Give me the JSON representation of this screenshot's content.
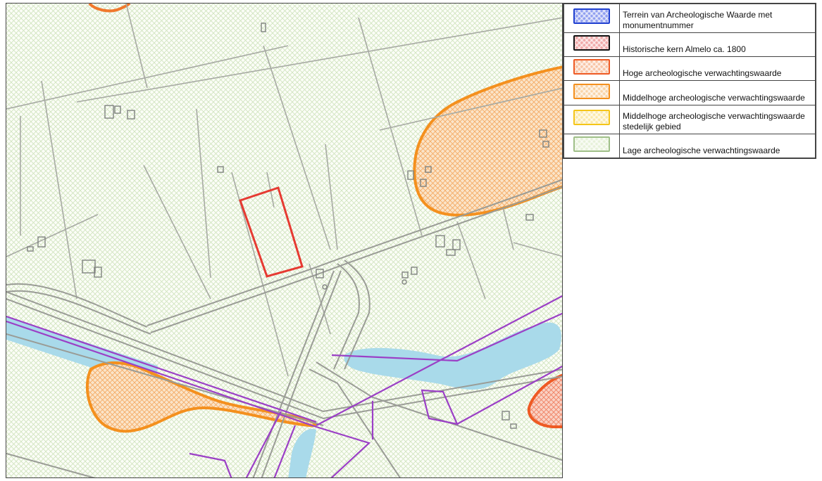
{
  "legend": {
    "items": [
      {
        "label": "Terrein van Archeologische Waarde met monumentnummer",
        "border": "#1f3fd0",
        "fill": "#8e9df0",
        "icon": "blue-hatch-swatch-icon"
      },
      {
        "label": "Historische kern Almelo ca. 1800",
        "border": "#111111",
        "fill": "#f0a6a6",
        "icon": "red-hatch-swatch-icon"
      },
      {
        "label": "Hoge archeologische verwachtingswaarde",
        "border": "#ee5a24",
        "fill": "#f8c3a3",
        "icon": "orange-red-hatch-swatch-icon"
      },
      {
        "label": "Middelhoge archeologische verwachtingswaarde",
        "border": "#f4901e",
        "fill": "#f9d3a6",
        "icon": "orange-hatch-swatch-icon"
      },
      {
        "label": "Middelhoge archeologische verwachtingswaarde stedelijk gebied",
        "border": "#f5c518",
        "fill": "#fbe9a6",
        "icon": "yellow-hatch-swatch-icon"
      },
      {
        "label": "Lage archeologische verwachtingswaarde",
        "border": "#9fbf88",
        "fill": "#e6f1d9",
        "icon": "green-hatch-swatch-icon"
      }
    ]
  },
  "map": {
    "colors": {
      "low_hatch": "#cfe3bd",
      "orange_zone": "#f4901e",
      "orange_fill": "#f9d9b3",
      "high_zone": "#ee5a24",
      "high_fill": "#f7c2b0",
      "water": "#a9daea",
      "study_area": "#e63a32",
      "purple_boundary": "#9b3fc6",
      "parcel_lines": "#a7aaa3",
      "roads": "#9a9c96"
    },
    "icons": [
      "study-area-outline",
      "building-icon",
      "water-channel",
      "purple-boundary-line"
    ]
  }
}
